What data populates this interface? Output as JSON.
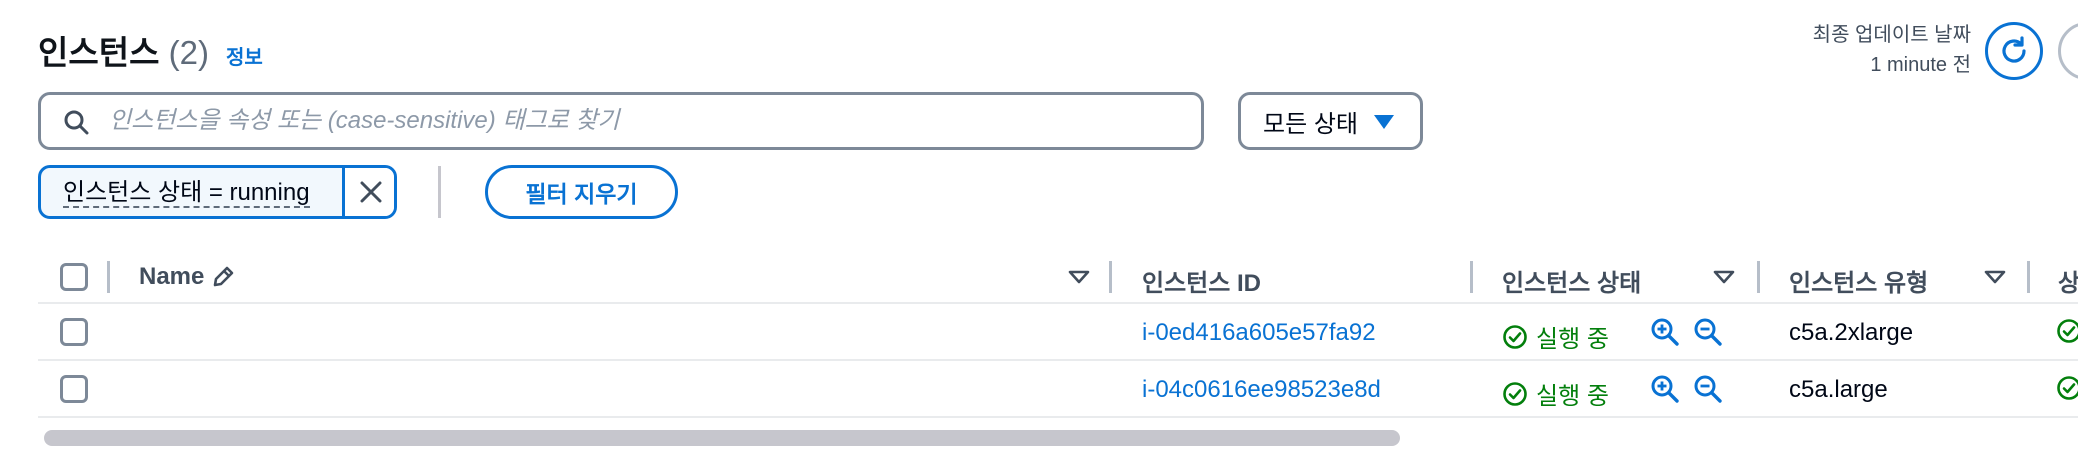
{
  "header": {
    "title": "인스턴스",
    "count": "(2)",
    "info_link": "정보",
    "last_updated_label": "최종 업데이트 날짜",
    "last_updated_value": "1 minute 전"
  },
  "search": {
    "placeholder": "인스턴스을 속성 또는 (case-sensitive) 태그로 찾기",
    "value": ""
  },
  "state_filter": {
    "selected": "모든 상태"
  },
  "filter_token": {
    "label": "인스턴스 상태 = running"
  },
  "clear_filters_label": "필터 지우기",
  "table": {
    "columns": {
      "name": "Name",
      "instance_id": "인스턴스 ID",
      "instance_state": "인스턴스 상태",
      "instance_type": "인스턴스 유형",
      "next": "상"
    },
    "rows": [
      {
        "name": "",
        "instance_id": "i-0ed416a605e57fa92",
        "state": "실행 중",
        "type": "c5a.2xlarge"
      },
      {
        "name": "",
        "instance_id": "i-04c0616ee98523e8d",
        "state": "실행 중",
        "type": "c5a.large"
      }
    ]
  },
  "colors": {
    "accent": "#0972d3",
    "success": "#037f0c",
    "border": "#7d8998"
  },
  "icons": {
    "search": "search-icon",
    "refresh": "refresh-icon",
    "close": "close-icon",
    "edit": "pencil-icon",
    "sort": "sort-caret-icon",
    "status": "check-circle-icon",
    "zoom_in": "zoom-in-icon",
    "zoom_out": "zoom-out-icon"
  }
}
